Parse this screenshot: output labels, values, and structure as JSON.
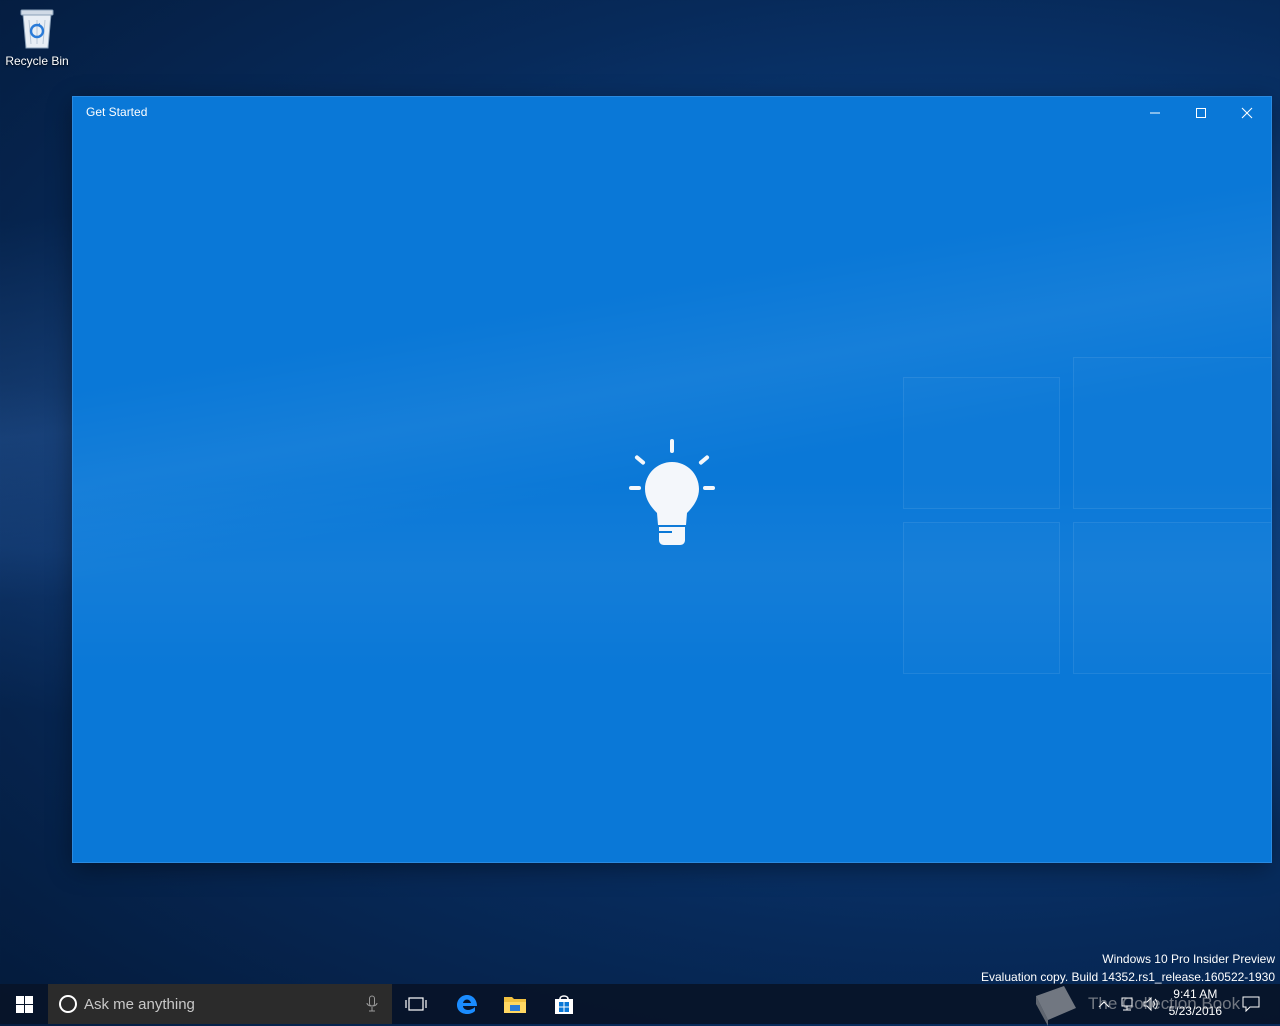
{
  "desktop": {
    "icons": [
      {
        "label": "Recycle Bin",
        "icon": "recycle-bin-icon"
      }
    ]
  },
  "window": {
    "title": "Get Started",
    "controls": {
      "minimize": "minimize-icon",
      "maximize": "maximize-icon",
      "close": "close-icon"
    },
    "center_icon": "lightbulb-icon",
    "background_color": "#0a78d7"
  },
  "watermark": {
    "line1": "Windows 10 Pro Insider Preview",
    "line2": "Evaluation copy. Build 14352.rs1_release.160522-1930"
  },
  "taskbar": {
    "search_placeholder": "Ask me anything",
    "pinned": [
      "task-view-icon",
      "edge-icon",
      "file-explorer-icon",
      "store-icon"
    ],
    "tray_icons": [
      "chevron-up-icon",
      "network-icon",
      "volume-icon",
      "action-center-icon"
    ],
    "time": "9:41 AM",
    "date": "5/23/2016"
  },
  "overlay_watermark": {
    "text": "The Collection Book"
  }
}
